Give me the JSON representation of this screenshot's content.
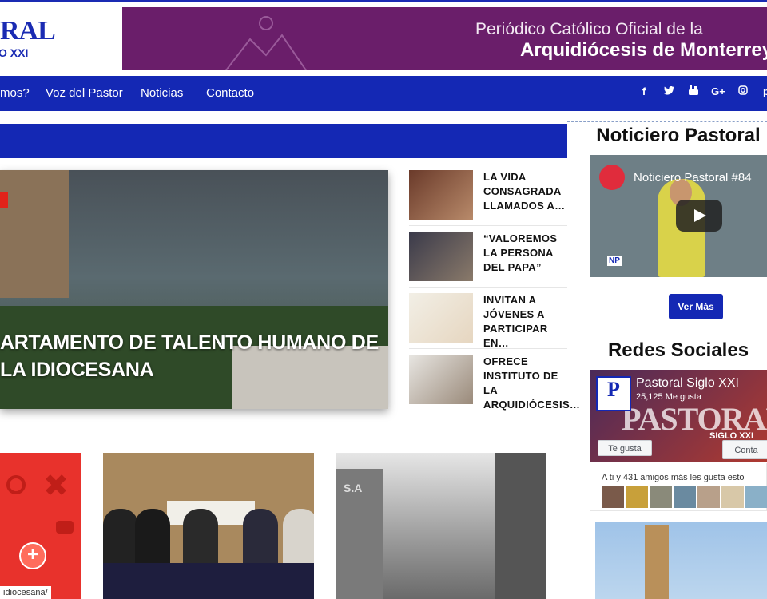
{
  "header": {
    "logo_big": "RAL",
    "logo_small": "O XXI",
    "banner_line1": "Periódico Católico Oficial de la",
    "banner_line2": "Arquidiócesis de Monterrey"
  },
  "nav": {
    "items": [
      "mos?",
      "Voz del Pastor",
      "Noticias",
      "Contacto"
    ],
    "social": [
      "f",
      "t",
      "yt",
      "G+",
      "ig",
      "p"
    ]
  },
  "hero": {
    "title": "ARTAMENTO DE TALENTO HUMANO DE LA IDIOCESANA"
  },
  "side_news": [
    {
      "title": "LA VIDA CONSAGRADA LLAMADOS A…"
    },
    {
      "title": "“VALOREMOS LA PERSONA DEL PAPA”"
    },
    {
      "title": "INVITAN A JÓVENES A PARTICIPAR EN…"
    },
    {
      "title": "OFRECE INSTITUTO DE LA ARQUIDIÓCESIS…"
    }
  ],
  "sidebar": {
    "noticiero_heading": "Noticiero Pastoral",
    "video_title": "Noticiero Pastoral #84",
    "video_badge": "NP",
    "ver_mas": "Ver Más",
    "redes_heading": "Redes Sociales",
    "fb_name": "Pastoral Siglo XXI",
    "fb_likes": "25,125 Me gusta",
    "fb_watermark": "PASTORAL",
    "fb_watermark2": "SIGLO XXI",
    "fb_like_button": "Te gusta",
    "fb_contact_button": "Conta",
    "friends_text": "A ti y 431 amigos más les gusta esto"
  },
  "cards": {
    "card1_url": "idiocesana/",
    "card3_sign": "S.A"
  },
  "colors": {
    "brand_blue": "#1428b4",
    "banner_purple": "#6a1e6a",
    "accent_red": "#e2231a"
  }
}
